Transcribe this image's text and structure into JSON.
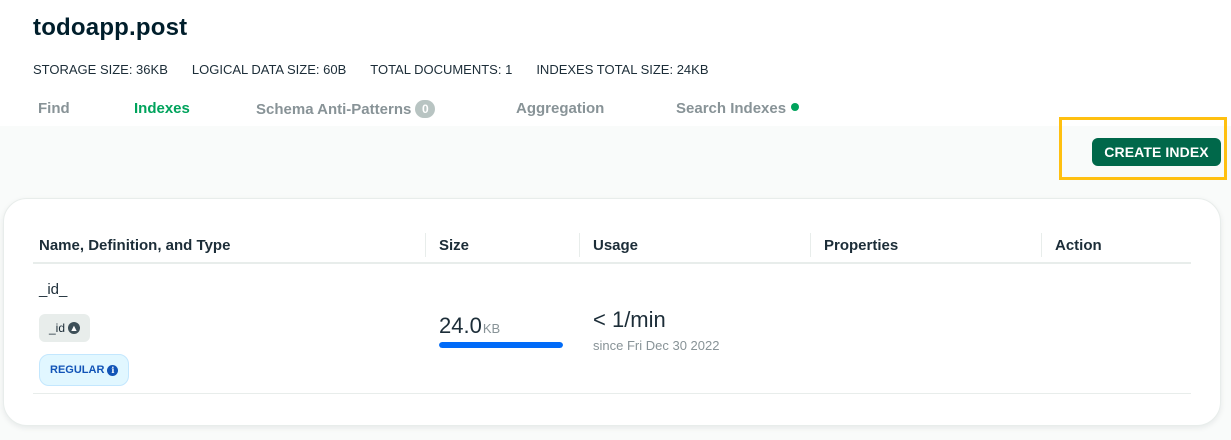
{
  "namespace": {
    "title": "todoapp.post"
  },
  "stats": [
    {
      "text": "STORAGE SIZE: 36KB"
    },
    {
      "text": "LOGICAL DATA SIZE: 60B"
    },
    {
      "text": "TOTAL DOCUMENTS: 1"
    },
    {
      "text": "INDEXES TOTAL SIZE: 24KB"
    }
  ],
  "tabs": {
    "find": "Find",
    "indexes": "Indexes",
    "schema": "Schema Anti-Patterns",
    "schema_count": "0",
    "aggregation": "Aggregation",
    "search": "Search Indexes",
    "active": "indexes"
  },
  "toolbar": {
    "create_label": "CREATE INDEX"
  },
  "table": {
    "headers": {
      "name": "Name, Definition, and Type",
      "size": "Size",
      "usage": "Usage",
      "properties": "Properties",
      "action": "Action"
    },
    "rows": [
      {
        "name": "_id_",
        "key": "_id",
        "key_direction_icon": "arrow-up-icon",
        "type": "REGULAR",
        "size_value": "24.0",
        "size_unit": "KB",
        "size_fraction": 1.0,
        "usage": "< 1/min",
        "since": "since Fri Dec 30 2022"
      }
    ]
  },
  "colors": {
    "accent_green": "#00a35c",
    "button_green": "#00684a",
    "highlight": "#ffc010",
    "size_bar": "#016bf8",
    "badge_blue": "#1254b7"
  }
}
